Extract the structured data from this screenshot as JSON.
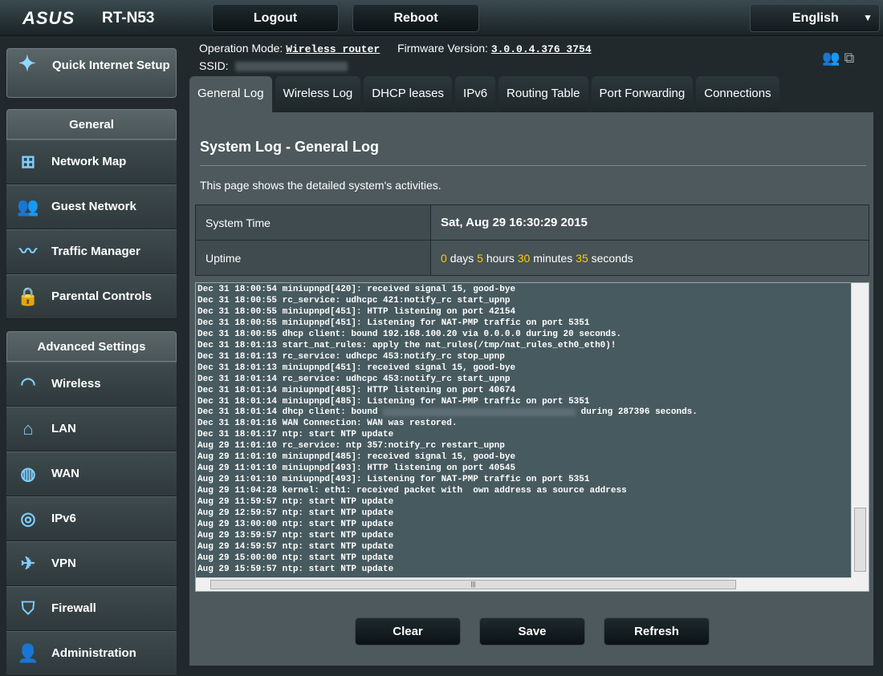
{
  "header": {
    "brand": "ASUS",
    "model": "RT-N53",
    "logout": "Logout",
    "reboot": "Reboot",
    "language": "English"
  },
  "info": {
    "op_mode_label": "Operation Mode:",
    "op_mode": "Wireless router",
    "fw_label": "Firmware Version:",
    "fw": "3.0.0.4.376_3754",
    "ssid_label": "SSID:"
  },
  "sidebar": {
    "qis": "Quick Internet Setup",
    "general": "General",
    "general_items": [
      "Network Map",
      "Guest Network",
      "Traffic Manager",
      "Parental Controls"
    ],
    "advanced": "Advanced Settings",
    "advanced_items": [
      "Wireless",
      "LAN",
      "WAN",
      "IPv6",
      "VPN",
      "Firewall",
      "Administration"
    ]
  },
  "tabs": [
    "General Log",
    "Wireless Log",
    "DHCP leases",
    "IPv6",
    "Routing Table",
    "Port Forwarding",
    "Connections"
  ],
  "main": {
    "title": "System Log - General Log",
    "desc": "This page shows the detailed system's activities.",
    "system_time_label": "System Time",
    "system_time": "Sat, Aug 29 16:30:29 2015",
    "uptime_label": "Uptime",
    "uptime": {
      "days": "0",
      "days_u": "days",
      "hours": "5",
      "hours_u": "hours",
      "minutes": "30",
      "minutes_u": "minutes",
      "seconds": "35",
      "seconds_u": "seconds"
    }
  },
  "log": [
    "Dec 31 18:00:54 miniupnpd[420]: received signal 15, good-bye",
    "Dec 31 18:00:55 rc_service: udhcpc 421:notify_rc start_upnp",
    "Dec 31 18:00:55 miniupnpd[451]: HTTP listening on port 42154",
    "Dec 31 18:00:55 miniupnpd[451]: Listening for NAT-PMP traffic on port 5351",
    "Dec 31 18:00:55 dhcp client: bound 192.168.100.20 via 0.0.0.0 during 20 seconds.",
    "Dec 31 18:01:13 start_nat_rules: apply the nat_rules(/tmp/nat_rules_eth0_eth0)!",
    "Dec 31 18:01:13 rc_service: udhcpc 453:notify_rc stop_upnp",
    "Dec 31 18:01:13 miniupnpd[451]: received signal 15, good-bye",
    "Dec 31 18:01:14 rc_service: udhcpc 453:notify_rc start_upnp",
    "Dec 31 18:01:14 miniupnpd[485]: HTTP listening on port 40674",
    "Dec 31 18:01:14 miniupnpd[485]: Listening for NAT-PMP traffic on port 5351",
    "Dec 31 18:01:14 dhcp client: bound ",
    "Dec 31 18:01:16 WAN Connection: WAN was restored.",
    "Dec 31 18:01:17 ntp: start NTP update",
    "Aug 29 11:01:10 rc_service: ntp 357:notify_rc restart_upnp",
    "Aug 29 11:01:10 miniupnpd[485]: received signal 15, good-bye",
    "Aug 29 11:01:10 miniupnpd[493]: HTTP listening on port 40545",
    "Aug 29 11:01:10 miniupnpd[493]: Listening for NAT-PMP traffic on port 5351",
    "Aug 29 11:04:28 kernel: eth1: received packet with  own address as source address",
    "Aug 29 11:59:57 ntp: start NTP update",
    "Aug 29 12:59:57 ntp: start NTP update",
    "Aug 29 13:00:00 ntp: start NTP update",
    "Aug 29 13:59:57 ntp: start NTP update",
    "Aug 29 14:59:57 ntp: start NTP update",
    "Aug 29 15:00:00 ntp: start NTP update",
    "Aug 29 15:59:57 ntp: start NTP update"
  ],
  "log_blur_suffix": " during 287396 seconds.",
  "buttons": {
    "clear": "Clear",
    "save": "Save",
    "refresh": "Refresh"
  }
}
